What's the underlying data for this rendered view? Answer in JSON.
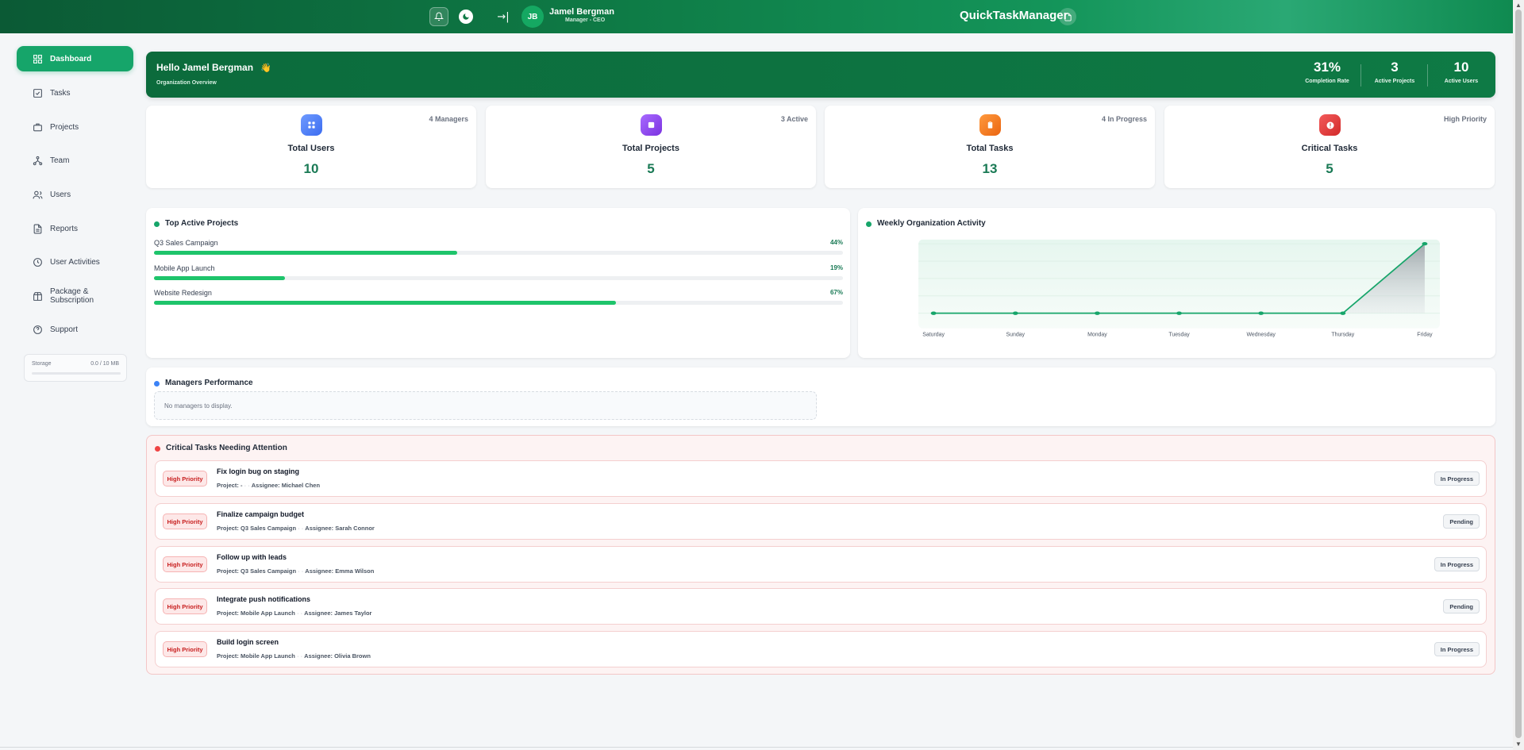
{
  "topbar": {
    "user_initials": "JB",
    "user_name": "Jamel Bergman",
    "user_role": "Manager - CEO",
    "app_name": "QuickTaskManager",
    "collapse_glyph": "→|"
  },
  "sidebar": {
    "items": [
      {
        "label": "Dashboard",
        "icon": "dashboard-icon",
        "active": true
      },
      {
        "label": "Tasks",
        "icon": "checkbox-icon"
      },
      {
        "label": "Projects",
        "icon": "briefcase-icon"
      },
      {
        "label": "Team",
        "icon": "team-icon"
      },
      {
        "label": "Users",
        "icon": "users-icon"
      },
      {
        "label": "Reports",
        "icon": "document-icon"
      },
      {
        "label": "User Activities",
        "icon": "clock-icon"
      },
      {
        "label": "Package & Subscription",
        "icon": "package-icon"
      },
      {
        "label": "Support",
        "icon": "help-icon"
      }
    ],
    "storage": {
      "label": "Storage",
      "value": "0.0 / 10 MB",
      "fraction": 0.0
    }
  },
  "hero": {
    "greeting": "Hello Jamel Bergman",
    "emoji": "👋",
    "subtitle": "Organization Overview",
    "stats": [
      {
        "value": "31%",
        "label": "Completion Rate"
      },
      {
        "value": "3",
        "label": "Active Projects"
      },
      {
        "value": "10",
        "label": "Active Users"
      }
    ]
  },
  "cards": [
    {
      "label": "Total Users",
      "value": "10",
      "badge": "4 Managers",
      "icon": "users-grid-icon",
      "color": "#4f7ef7"
    },
    {
      "label": "Total Projects",
      "value": "5",
      "badge": "3 Active",
      "icon": "folder-icon",
      "color": "#8b44e8"
    },
    {
      "label": "Total Tasks",
      "value": "13",
      "badge": "4 In Progress",
      "icon": "clipboard-icon",
      "color": "#f27a1f"
    },
    {
      "label": "Critical Tasks",
      "value": "5",
      "badge": "High Priority",
      "icon": "alert-icon",
      "color": "#e03c3c"
    }
  ],
  "top_projects": {
    "title": "Top Active Projects",
    "items": [
      {
        "name": "Q3 Sales Campaign",
        "pct": "44%",
        "fraction": 0.44
      },
      {
        "name": "Mobile App Launch",
        "pct": "19%",
        "fraction": 0.19
      },
      {
        "name": "Website Redesign",
        "pct": "67%",
        "fraction": 0.67
      }
    ]
  },
  "weekly_activity": {
    "title": "Weekly Organization Activity"
  },
  "chart_data": {
    "type": "area",
    "categories": [
      "Saturday",
      "Sunday",
      "Monday",
      "Tuesday",
      "Wednesday",
      "Thursday",
      "Friday"
    ],
    "values": [
      0,
      0,
      0,
      0,
      0,
      0,
      4
    ],
    "ylim": [
      0,
      4
    ],
    "grid": true,
    "color": "#16a56a"
  },
  "managers": {
    "title": "Managers Performance",
    "empty_text": "No managers to display."
  },
  "critical": {
    "title": "Critical Tasks Needing Attention",
    "tasks": [
      {
        "priority": "High Priority",
        "title": "Fix login bug on staging",
        "project": "Project: -",
        "assignee": "Assignee: Michael Chen",
        "status": "In Progress"
      },
      {
        "priority": "High Priority",
        "title": "Finalize campaign budget",
        "project": "Project: Q3 Sales Campaign",
        "assignee": "Assignee: Sarah Connor",
        "status": "Pending"
      },
      {
        "priority": "High Priority",
        "title": "Follow up with leads",
        "project": "Project: Q3 Sales Campaign",
        "assignee": "Assignee: Emma Wilson",
        "status": "In Progress"
      },
      {
        "priority": "High Priority",
        "title": "Integrate push notifications",
        "project": "Project: Mobile App Launch",
        "assignee": "Assignee: James Taylor",
        "status": "Pending"
      },
      {
        "priority": "High Priority",
        "title": "Build login screen",
        "project": "Project: Mobile App Launch",
        "assignee": "Assignee: Olivia Brown",
        "status": "In Progress"
      }
    ]
  },
  "colors": {
    "brand": "#0e7a45",
    "accent": "#16a56a",
    "danger": "#e03c3c"
  }
}
